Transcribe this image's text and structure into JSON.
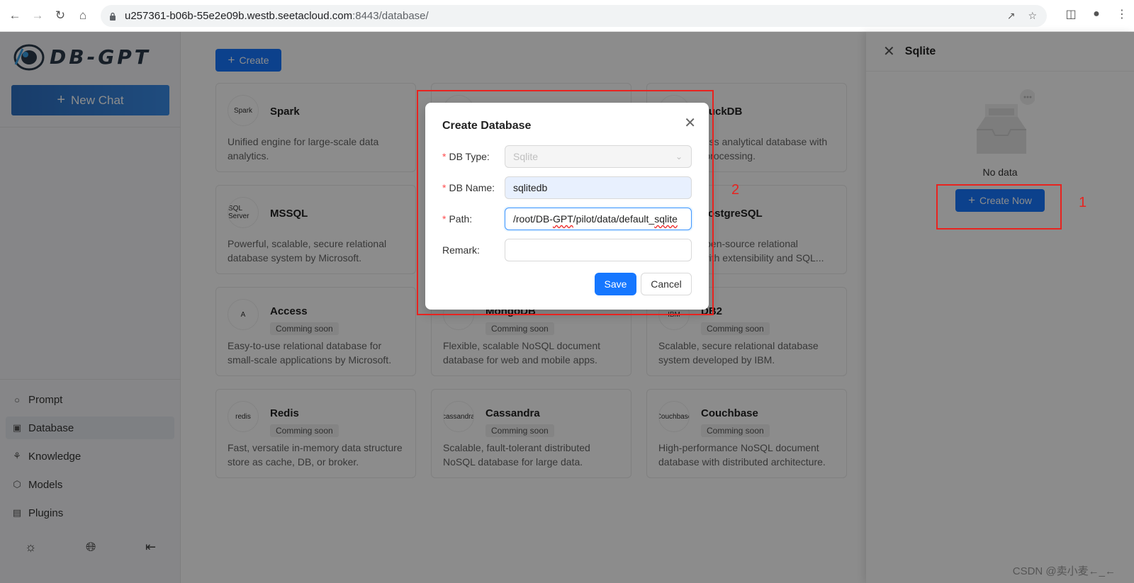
{
  "browser": {
    "url_host": "u257361-b06b-55e2e09b.westb.seetacloud.com",
    "url_port_path": ":8443/database/"
  },
  "sidebar": {
    "logo_text": "DB-GPT",
    "new_chat_label": "New Chat",
    "menu": [
      {
        "label": "Prompt",
        "icon": "chat-bubble-icon"
      },
      {
        "label": "Database",
        "icon": "database-icon",
        "active": true
      },
      {
        "label": "Knowledge",
        "icon": "knowledge-icon"
      },
      {
        "label": "Models",
        "icon": "cube-icon"
      },
      {
        "label": "Plugins",
        "icon": "plugin-icon"
      }
    ],
    "bottom_icons": [
      "sun-icon",
      "globe-icon",
      "collapse-menu-icon"
    ]
  },
  "main": {
    "create_label": "Create",
    "cards": [
      {
        "title": "Spark",
        "desc": "Unified engine for large-scale data analytics.",
        "badge": "",
        "icon_text": "Spark"
      },
      {
        "title": "",
        "desc": "",
        "badge": "",
        "icon_text": ""
      },
      {
        "title": "DuckDB",
        "desc": "An in-process analytical database with fast query processing.",
        "badge": "",
        "icon_text": ""
      },
      {
        "title": "MSSQL",
        "desc": "Powerful, scalable, secure relational database system by Microsoft.",
        "badge": "",
        "icon_text": "SQL Server"
      },
      {
        "title": "",
        "desc": "",
        "badge": "",
        "icon_text": ""
      },
      {
        "title": "PostgreSQL",
        "desc": "Powerful open-source relational database with extensibility and SQL...",
        "badge": "",
        "icon_text": ""
      },
      {
        "title": "Access",
        "desc": "Easy-to-use relational database for small-scale applications by Microsoft.",
        "badge": "Comming soon",
        "icon_text": "A"
      },
      {
        "title": "MongoDB",
        "desc": "Flexible, scalable NoSQL document database for web and mobile apps.",
        "badge": "Comming soon",
        "icon_text": ""
      },
      {
        "title": "DB2",
        "desc": "Scalable, secure relational database system developed by IBM.",
        "badge": "Comming soon",
        "icon_text": "IBM"
      },
      {
        "title": "Redis",
        "desc": "Fast, versatile in-memory data structure store as cache, DB, or broker.",
        "badge": "Comming soon",
        "icon_text": "redis"
      },
      {
        "title": "Cassandra",
        "desc": "Scalable, fault-tolerant distributed NoSQL database for large data.",
        "badge": "Comming soon",
        "icon_text": "cassandra"
      },
      {
        "title": "Couchbase",
        "desc": "High-performance NoSQL document database with distributed architecture.",
        "badge": "Comming soon",
        "icon_text": "Couchbase"
      }
    ]
  },
  "drawer": {
    "title": "Sqlite",
    "empty_text": "No data",
    "create_now_label": "Create Now"
  },
  "modal": {
    "title": "Create Database",
    "db_type_label": "DB Type:",
    "db_type_value": "Sqlite",
    "db_name_label": "DB Name:",
    "db_name_value": "sqlitedb",
    "path_label": "Path:",
    "path_value_prefix": "/root/DB-",
    "path_value_squiggle1": "GPT",
    "path_value_middle": "/pilot/data/default_",
    "path_value_squiggle2": "sqlite",
    "remark_label": "Remark:",
    "remark_value": "",
    "save_label": "Save",
    "cancel_label": "Cancel"
  },
  "annotations": {
    "num1": "1",
    "num2": "2"
  },
  "watermark": "CSDN @卖小麦←_←",
  "colors": {
    "primary": "#1677ff",
    "annotation_red": "#e8231f"
  }
}
